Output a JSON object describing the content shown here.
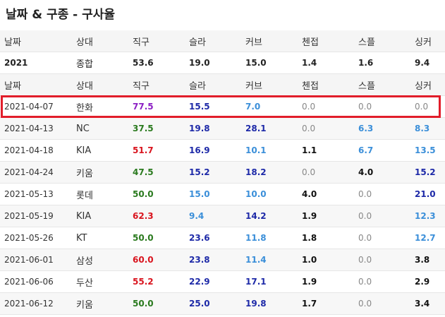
{
  "title": "날짜 & 구종 - 구사율",
  "headers": [
    "날짜",
    "상대",
    "직구",
    "슬라",
    "커브",
    "첸접",
    "스플",
    "싱커"
  ],
  "summary": {
    "year": "2021",
    "type": "종합",
    "values": [
      "53.6",
      "19.0",
      "15.0",
      "1.4",
      "1.6",
      "9.4"
    ]
  },
  "rows": [
    {
      "date": "2021-04-07",
      "opp": "한화",
      "vals": [
        "77.5",
        "15.5",
        "7.0",
        "0.0",
        "0.0",
        "0.0"
      ],
      "colors": [
        "#8b1ec4",
        "#1e2aa8",
        "#3b8fd9",
        "#888888",
        "#888888",
        "#888888"
      ],
      "bold": [
        true,
        true,
        true,
        false,
        false,
        false
      ]
    },
    {
      "date": "2021-04-13",
      "opp": "NC",
      "vals": [
        "37.5",
        "19.8",
        "28.1",
        "0.0",
        "6.3",
        "8.3"
      ],
      "colors": [
        "#2a7a1e",
        "#1e2aa8",
        "#1e2aa8",
        "#888888",
        "#3b8fd9",
        "#3b8fd9"
      ],
      "bold": [
        true,
        true,
        true,
        false,
        true,
        true
      ]
    },
    {
      "date": "2021-04-18",
      "opp": "KIA",
      "vals": [
        "51.7",
        "16.9",
        "10.1",
        "1.1",
        "6.7",
        "13.5"
      ],
      "colors": [
        "#d9141e",
        "#1e2aa8",
        "#3b8fd9",
        "#111111",
        "#3b8fd9",
        "#3b8fd9"
      ],
      "bold": [
        true,
        true,
        true,
        true,
        true,
        true
      ]
    },
    {
      "date": "2021-04-24",
      "opp": "키움",
      "vals": [
        "47.5",
        "15.2",
        "18.2",
        "0.0",
        "4.0",
        "15.2"
      ],
      "colors": [
        "#2a7a1e",
        "#1e2aa8",
        "#1e2aa8",
        "#888888",
        "#111111",
        "#1e2aa8"
      ],
      "bold": [
        true,
        true,
        true,
        false,
        true,
        true
      ]
    },
    {
      "date": "2021-05-13",
      "opp": "롯데",
      "vals": [
        "50.0",
        "15.0",
        "10.0",
        "4.0",
        "0.0",
        "21.0"
      ],
      "colors": [
        "#2a7a1e",
        "#3b8fd9",
        "#3b8fd9",
        "#111111",
        "#888888",
        "#1e2aa8"
      ],
      "bold": [
        true,
        true,
        true,
        true,
        false,
        true
      ]
    },
    {
      "date": "2021-05-19",
      "opp": "KIA",
      "vals": [
        "62.3",
        "9.4",
        "14.2",
        "1.9",
        "0.0",
        "12.3"
      ],
      "colors": [
        "#d9141e",
        "#3b8fd9",
        "#1e2aa8",
        "#111111",
        "#888888",
        "#3b8fd9"
      ],
      "bold": [
        true,
        true,
        true,
        true,
        false,
        true
      ]
    },
    {
      "date": "2021-05-26",
      "opp": "KT",
      "vals": [
        "50.0",
        "23.6",
        "11.8",
        "1.8",
        "0.0",
        "12.7"
      ],
      "colors": [
        "#2a7a1e",
        "#1e2aa8",
        "#3b8fd9",
        "#111111",
        "#888888",
        "#3b8fd9"
      ],
      "bold": [
        true,
        true,
        true,
        true,
        false,
        true
      ]
    },
    {
      "date": "2021-06-01",
      "opp": "삼성",
      "vals": [
        "60.0",
        "23.8",
        "11.4",
        "1.0",
        "0.0",
        "3.8"
      ],
      "colors": [
        "#d9141e",
        "#1e2aa8",
        "#3b8fd9",
        "#111111",
        "#888888",
        "#111111"
      ],
      "bold": [
        true,
        true,
        true,
        true,
        false,
        true
      ]
    },
    {
      "date": "2021-06-06",
      "opp": "두산",
      "vals": [
        "55.2",
        "22.9",
        "17.1",
        "1.9",
        "0.0",
        "2.9"
      ],
      "colors": [
        "#d9141e",
        "#1e2aa8",
        "#1e2aa8",
        "#111111",
        "#888888",
        "#111111"
      ],
      "bold": [
        true,
        true,
        true,
        true,
        false,
        true
      ]
    },
    {
      "date": "2021-06-12",
      "opp": "키움",
      "vals": [
        "50.0",
        "25.0",
        "19.8",
        "1.7",
        "0.0",
        "3.4"
      ],
      "colors": [
        "#2a7a1e",
        "#1e2aa8",
        "#1e2aa8",
        "#111111",
        "#888888",
        "#111111"
      ],
      "bold": [
        true,
        true,
        true,
        true,
        false,
        true
      ]
    }
  ],
  "highlight_color": "#e11d2a"
}
